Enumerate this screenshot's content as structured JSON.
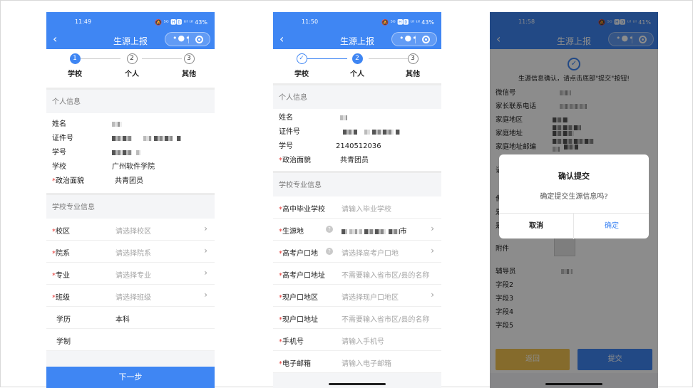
{
  "colors": {
    "primary": "#3f86f3",
    "warning": "#f3c451",
    "required": "#e53935"
  },
  "phone1": {
    "status_time": "11:49",
    "status_icons": "🔕 ⁵ᴳ 🅷🅳 ᵗᴵˡ ᵗᴵˡ 43%",
    "nav_title": "生源上报",
    "back_icon": "‹",
    "steps": [
      {
        "num": "1",
        "label": "学校"
      },
      {
        "num": "2",
        "label": "个人"
      },
      {
        "num": "3",
        "label": "其他"
      }
    ],
    "section_personal": "个人信息",
    "personal_labels": {
      "name": "姓名",
      "id": "证件号",
      "student_no": "学号",
      "school": "学校",
      "politics": "政治面貌"
    },
    "school_value": "广州软件学院",
    "politics_value": "共青团员",
    "required_mark": "*",
    "section_school": "学校专业信息",
    "form": [
      {
        "label": "校区",
        "placeholder": "请选择校区"
      },
      {
        "label": "院系",
        "placeholder": "请选择院系"
      },
      {
        "label": "专业",
        "placeholder": "请选择专业"
      },
      {
        "label": "班级",
        "placeholder": "请选择班级"
      }
    ],
    "education_label": "学历",
    "education_value": "本科",
    "duration_label": "学制",
    "next_button": "下一步"
  },
  "phone2": {
    "status_time": "11:50",
    "status_icons": "🔕 ⁵ᴳ 🅷🅳 ᵗᴵˡ ᵗᴵˡ 43%",
    "nav_title": "生源上报",
    "step1_check": "✓",
    "steps": [
      {
        "num": "",
        "label": "学校"
      },
      {
        "num": "2",
        "label": "个人"
      },
      {
        "num": "3",
        "label": "其他"
      }
    ],
    "section_personal": "个人信息",
    "name_label": "姓名",
    "id_label": "证件号",
    "student_no_label": "学号",
    "student_no_value": "2140512036",
    "politics_label": "政治面貌",
    "politics_value": "共青团员",
    "section_school": "学校专业信息",
    "hs_label": "高中毕业学校",
    "hs_placeholder": "请输入毕业学校",
    "origin_label": "生源地",
    "origin_value_suffix": "市",
    "exam_hukou_label": "高考户口地",
    "exam_hukou_placeholder": "请选择高考户口地",
    "exam_hukou_addr_label": "高考户口地址",
    "exam_hukou_addr_placeholder": "不需要输入省市区/县的名称",
    "cur_hukou_label": "现户口地区",
    "cur_hukou_placeholder": "请选择现户口地区",
    "cur_hukou_addr_label": "现户口地址",
    "cur_hukou_addr_placeholder": "不需要输入省市区/县的名称",
    "phone_label": "手机号",
    "phone_placeholder": "请输入手机号",
    "email_label": "电子邮箱",
    "email_placeholder": "请输入电子邮箱",
    "help_icon": "?"
  },
  "phone3": {
    "status_time": "11:58",
    "status_icons": "🔕 ⁵ᴳ 🅷🅳 ᵗᴵˡ ᵗᴵˡ 41%",
    "nav_title": "生源上报",
    "confirm_msg": "生源信息确认，请点击底部\"提交\"按钮!",
    "rows": {
      "wechat": "微信号",
      "parent_phone": "家长联系电话",
      "family_area": "家庭地区",
      "family_addr": "家庭地址",
      "family_zip": "家庭地址邮编",
      "attachment": "附件",
      "counselor": "辅导员",
      "field2": "字段2",
      "field3": "字段3",
      "field4": "字段4",
      "field5": "字段5"
    },
    "cut_chars": [
      "证",
      "僬",
      "是",
      "是"
    ],
    "back_button": "返回",
    "submit_button": "提交",
    "modal": {
      "title": "确认提交",
      "content": "确定提交生源信息吗?",
      "cancel": "取消",
      "confirm": "确定"
    }
  }
}
